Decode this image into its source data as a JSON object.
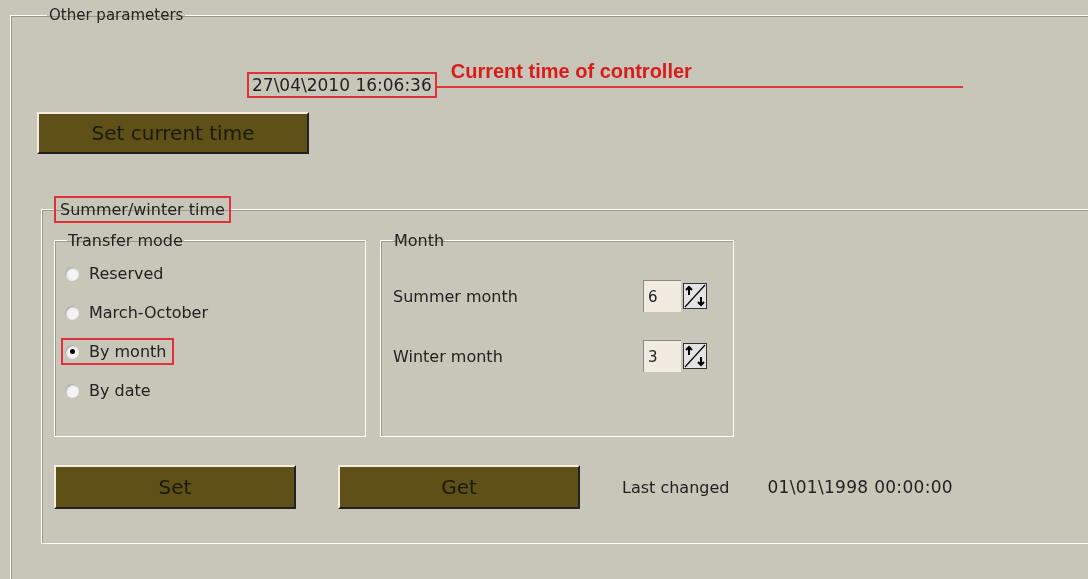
{
  "group_title": "Other parameters",
  "current_time": {
    "value": "27\\04\\2010 16:06:36",
    "annotated": true
  },
  "callout": "Current time of controller",
  "set_time_button": "Set current time",
  "dst_group": {
    "title": "Summer/winter time",
    "annotated": true
  },
  "transfer_mode": {
    "title": "Transfer mode",
    "options": [
      {
        "label": "Reserved",
        "selected": false,
        "annotated": false
      },
      {
        "label": "March-October",
        "selected": false,
        "annotated": false
      },
      {
        "label": "By month",
        "selected": true,
        "annotated": true
      },
      {
        "label": "By date",
        "selected": false,
        "annotated": false
      }
    ]
  },
  "month": {
    "title": "Month",
    "fields": [
      {
        "label": "Summer month",
        "value": "6"
      },
      {
        "label": "Winter month",
        "value": "3"
      }
    ]
  },
  "buttons": [
    "Set",
    "Get"
  ],
  "last_changed": {
    "label": "Last changed",
    "value": "01\\01\\1998 00:00:00"
  }
}
